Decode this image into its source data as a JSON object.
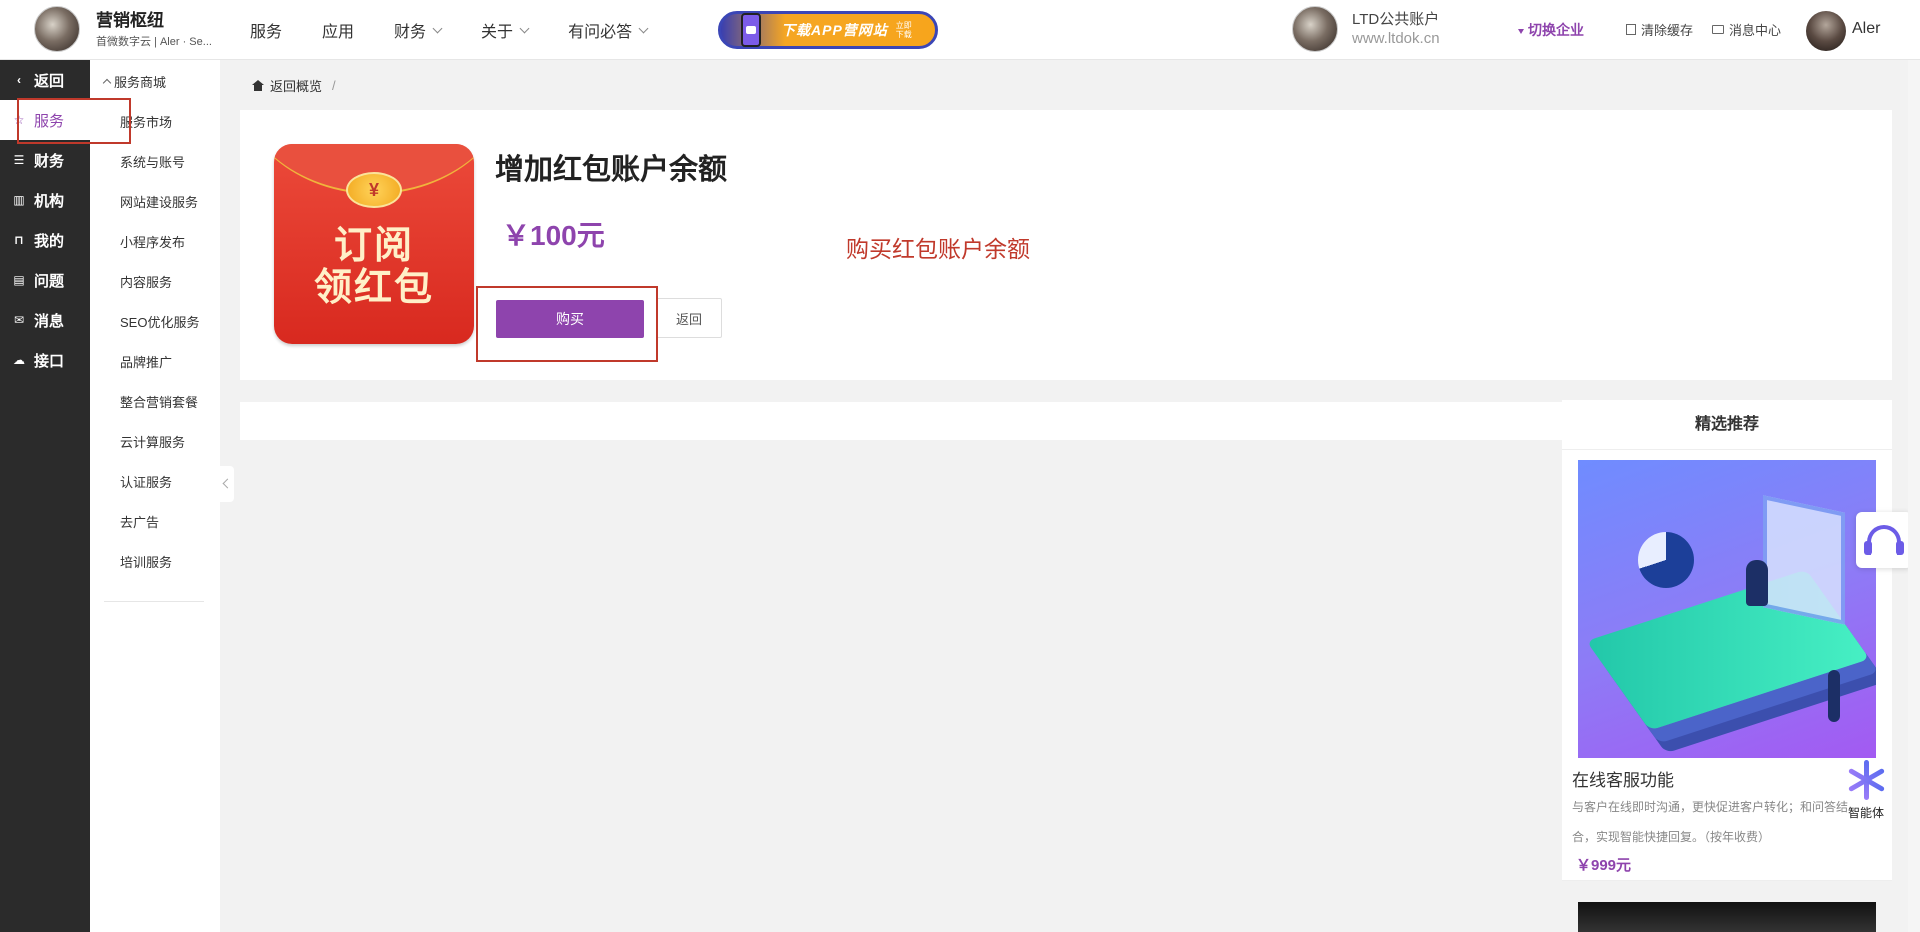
{
  "header": {
    "brand_title": "营销枢纽",
    "brand_subtitle": "首微数字云 | Aler · Se...",
    "nav": [
      {
        "label": "服务",
        "has_dropdown": false
      },
      {
        "label": "应用",
        "has_dropdown": false
      },
      {
        "label": "财务",
        "has_dropdown": true
      },
      {
        "label": "关于",
        "has_dropdown": true
      },
      {
        "label": "有问必答",
        "has_dropdown": true
      }
    ],
    "app_banner_text": "下载APP营网站",
    "app_banner_tag": "立即下载",
    "account_name": "LTD公共账户",
    "account_url": "www.ltdok.cn",
    "switch_enterprise": "切换企业",
    "clear_cache": "清除缓存",
    "message_center": "消息中心",
    "user_name": "Aler"
  },
  "sidebar": {
    "items": [
      {
        "label": "返回",
        "icon": "chevron-left-icon"
      },
      {
        "label": "服务",
        "icon": "star-icon",
        "active": true
      },
      {
        "label": "财务",
        "icon": "database-icon"
      },
      {
        "label": "机构",
        "icon": "building-icon"
      },
      {
        "label": "我的",
        "icon": "bookmark-icon"
      },
      {
        "label": "问题",
        "icon": "document-icon"
      },
      {
        "label": "消息",
        "icon": "mail-icon"
      },
      {
        "label": "接口",
        "icon": "cloud-icon"
      }
    ]
  },
  "submenu": {
    "group": "服务商城",
    "items": [
      "服务市场",
      "系统与账号",
      "网站建设服务",
      "小程序发布",
      "内容服务",
      "SEO优化服务",
      "品牌推广",
      "整合营销套餐",
      "云计算服务",
      "认证服务",
      "去广告",
      "培训服务"
    ]
  },
  "breadcrumb": {
    "home": "返回概览",
    "separator": "/"
  },
  "product": {
    "image_text_line1": "订阅",
    "image_text_line2": "领红包",
    "coin_symbol": "¥",
    "title": "增加红包账户余额",
    "price": "￥100元",
    "buy_label": "购买",
    "back_label": "返回",
    "annotation": "购买红包账户余额"
  },
  "recommend": {
    "title": "精选推荐",
    "item_name": "在线客服功能",
    "item_desc": "与客户在线即时沟通，更快促进客户转化；和问答结合，实现智能快捷回复。（按年收费）",
    "item_price": "￥999元"
  },
  "widgets": {
    "agent_label": "智能体"
  },
  "colors": {
    "accent": "#8e44ad",
    "sidebar_bg": "#2b2b2b",
    "annotation_red": "#c0392b"
  }
}
